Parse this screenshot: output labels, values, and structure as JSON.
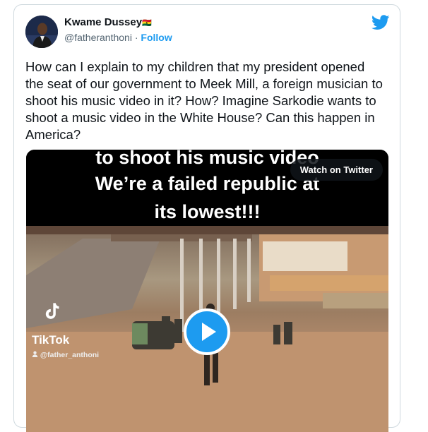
{
  "author": {
    "name": "Kwame Dussey",
    "name_emoji": "🇬🇭",
    "handle": "@fatheranthoni",
    "separator": " · ",
    "follow_label": "Follow"
  },
  "tweet": {
    "text": "How can I explain to my children that my president opened the seat of our government to Meek Mill, a foreign musician to shoot his music video in it? How? Imagine Sarkodie wants to shoot a music video in the White House? Can this happen in America?"
  },
  "video": {
    "captions": [
      "to shoot his music video",
      "We’re a failed republic at",
      "its lowest!!!"
    ],
    "watch_label": "Watch on Twitter",
    "watermark_label": "TikTok",
    "watermark_user": "@father_anthoni"
  },
  "colors": {
    "accent": "#1d9bf0",
    "text": "#0f1419",
    "muted": "#536471"
  },
  "icons": [
    "twitter-bird-icon",
    "play-icon",
    "tiktok-icon",
    "user-icon"
  ]
}
